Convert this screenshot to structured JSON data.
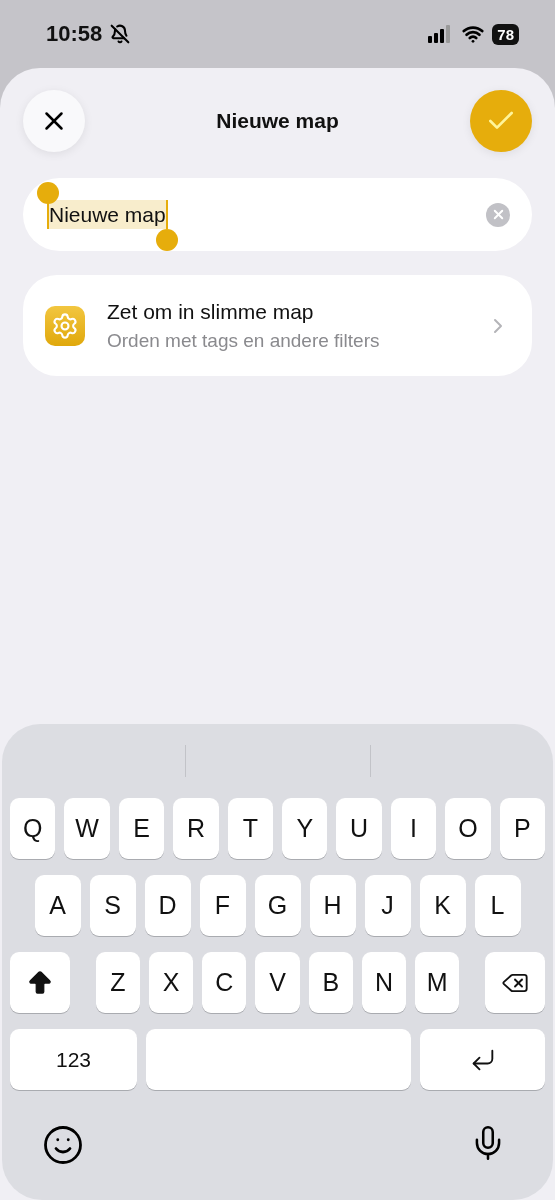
{
  "status_bar": {
    "time": "10:58",
    "silent": true,
    "battery": "78"
  },
  "header": {
    "title": "Nieuwe map"
  },
  "name_field": {
    "value": "Nieuwe map",
    "selected": true
  },
  "smart_folder_row": {
    "title": "Zet om in slimme map",
    "subtitle": "Orden met tags en andere filters"
  },
  "keyboard": {
    "rows": [
      [
        {
          "kind": "letter",
          "label": "Q"
        },
        {
          "kind": "letter",
          "label": "W"
        },
        {
          "kind": "letter",
          "label": "E"
        },
        {
          "kind": "letter",
          "label": "R"
        },
        {
          "kind": "letter",
          "label": "T"
        },
        {
          "kind": "letter",
          "label": "Y"
        },
        {
          "kind": "letter",
          "label": "U"
        },
        {
          "kind": "letter",
          "label": "I"
        },
        {
          "kind": "letter",
          "label": "O"
        },
        {
          "kind": "letter",
          "label": "P"
        }
      ],
      [
        {
          "kind": "letter",
          "label": "A"
        },
        {
          "kind": "letter",
          "label": "S"
        },
        {
          "kind": "letter",
          "label": "D"
        },
        {
          "kind": "letter",
          "label": "F"
        },
        {
          "kind": "letter",
          "label": "G"
        },
        {
          "kind": "letter",
          "label": "H"
        },
        {
          "kind": "letter",
          "label": "J"
        },
        {
          "kind": "letter",
          "label": "K"
        },
        {
          "kind": "letter",
          "label": "L"
        }
      ],
      [
        {
          "kind": "shift",
          "on": true
        },
        {
          "kind": "letter",
          "label": "Z"
        },
        {
          "kind": "letter",
          "label": "X"
        },
        {
          "kind": "letter",
          "label": "C"
        },
        {
          "kind": "letter",
          "label": "V"
        },
        {
          "kind": "letter",
          "label": "B"
        },
        {
          "kind": "letter",
          "label": "N"
        },
        {
          "kind": "letter",
          "label": "M"
        },
        {
          "kind": "backspace"
        }
      ],
      [
        {
          "kind": "numbers",
          "label": "123"
        },
        {
          "kind": "space"
        },
        {
          "kind": "return"
        }
      ]
    ]
  }
}
